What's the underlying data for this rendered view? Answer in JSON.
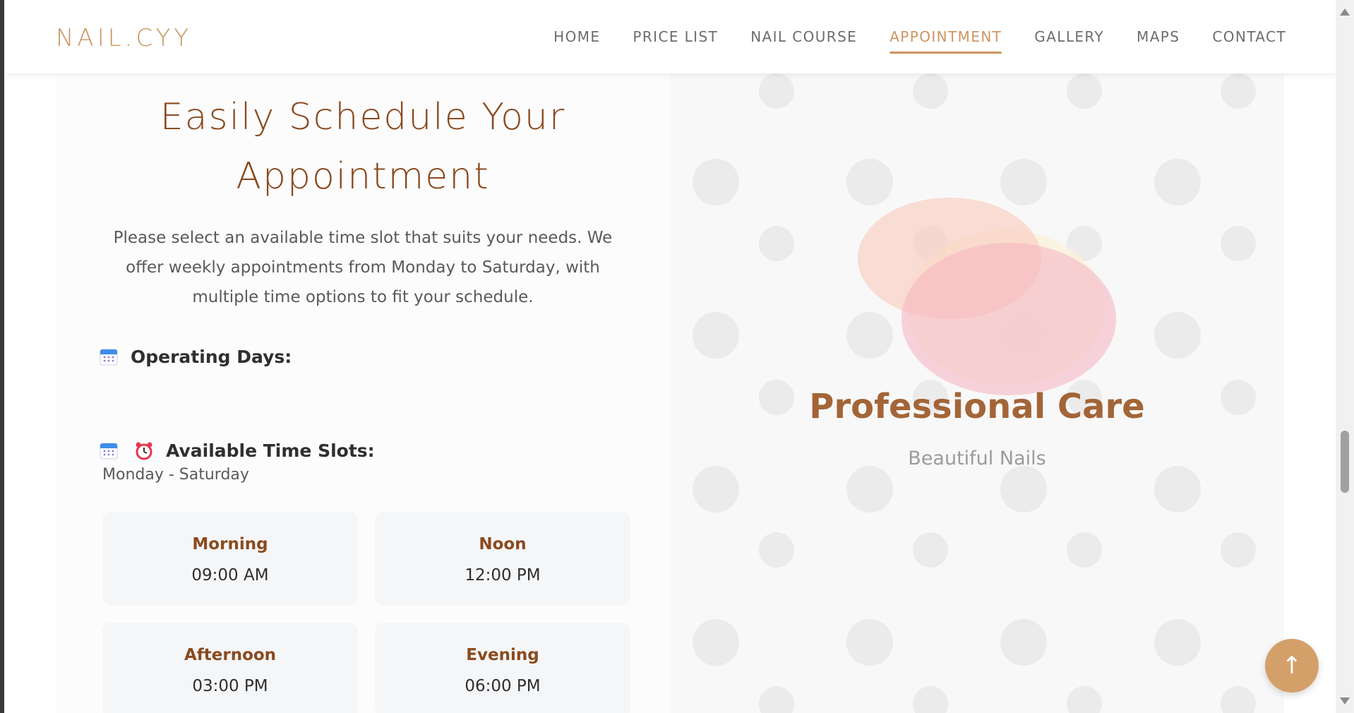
{
  "header": {
    "logo": "NAIL.CYY",
    "nav": [
      {
        "label": "HOME"
      },
      {
        "label": "PRICE LIST"
      },
      {
        "label": "NAIL COURSE"
      },
      {
        "label": "APPOINTMENT",
        "active": true
      },
      {
        "label": "GALLERY"
      },
      {
        "label": "MAPS"
      },
      {
        "label": "CONTACT"
      }
    ]
  },
  "appointment": {
    "title_line1": "Easily Schedule Your",
    "title_line2": "Appointment",
    "intro": "Please select an available time slot that suits your needs. We offer weekly appointments from Monday to Saturday, with multiple time options to fit your schedule.",
    "operating_days_label": "Operating Days:",
    "operating_days_value": "Monday - Saturday",
    "time_slots_label": "Available Time Slots:",
    "slots": [
      {
        "name": "Morning",
        "time": "09:00 AM"
      },
      {
        "name": "Noon",
        "time": "12:00 PM"
      },
      {
        "name": "Afternoon",
        "time": "03:00 PM"
      },
      {
        "name": "Evening",
        "time": "06:00 PM"
      }
    ]
  },
  "feature": {
    "title": "Professional Care",
    "subtitle": "Beautiful Nails"
  },
  "icons": {
    "calendar": "calendar-icon",
    "alarm": "alarm-clock-icon",
    "back_to_top": "arrow-up-icon"
  },
  "back_to_top": "↑",
  "colors": {
    "accent": "#cf9560",
    "brown": "#8a4a1e",
    "feature_title": "#a36537",
    "button": "#d3a06a"
  }
}
